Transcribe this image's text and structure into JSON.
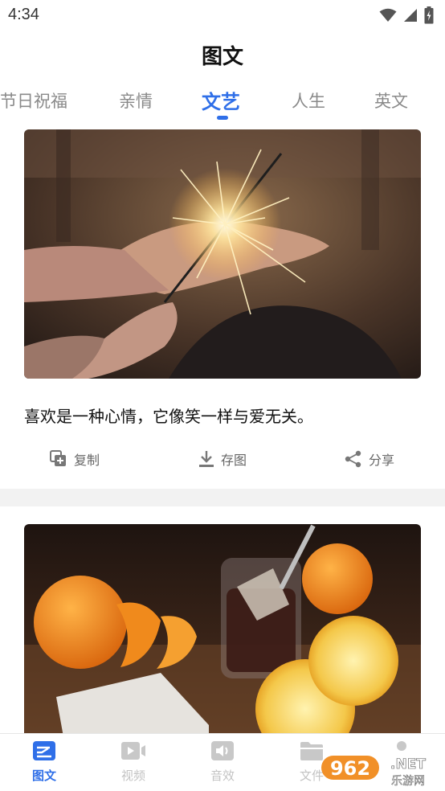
{
  "status_bar": {
    "time": "4:34"
  },
  "page": {
    "title": "图文"
  },
  "tabs": [
    {
      "label": "节日祝福",
      "active": false
    },
    {
      "label": "亲情",
      "active": false
    },
    {
      "label": "文艺",
      "active": true
    },
    {
      "label": "人生",
      "active": false
    },
    {
      "label": "英文",
      "active": false
    }
  ],
  "cards": [
    {
      "text": "喜欢是一种心情，它像笑一样与爱无关。",
      "actions": {
        "copy": "复制",
        "save": "存图",
        "share": "分享"
      }
    }
  ],
  "bottom_nav": [
    {
      "label": "图文",
      "active": true
    },
    {
      "label": "视频",
      "active": false
    },
    {
      "label": "音效",
      "active": false
    },
    {
      "label": "文件",
      "active": false
    }
  ],
  "watermark": {
    "number": "962",
    "suffix": ".NET",
    "site": "乐游网"
  },
  "colors": {
    "accent": "#2f6fe8",
    "inactive": "#8a8a8a"
  }
}
